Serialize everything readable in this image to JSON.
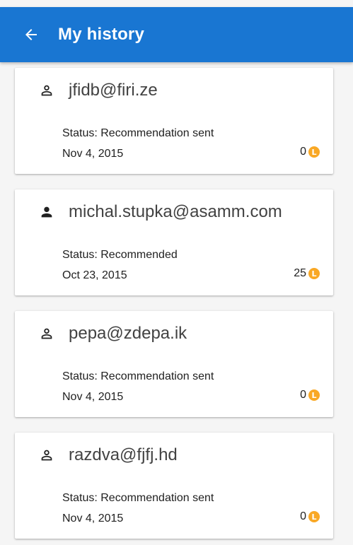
{
  "app_bar": {
    "title": "My history",
    "back_icon": "arrow-left-icon",
    "color": "#1976d2"
  },
  "history": [
    {
      "email": "jfidb@firi.ze",
      "status": "Status: Recommendation sent",
      "date": "Nov 4, 2015",
      "points": "0",
      "icon": "person-outline-icon"
    },
    {
      "email": "michal.stupka@asamm.com",
      "status": "Status: Recommended",
      "date": "Oct 23, 2015",
      "points": "25",
      "icon": "person-filled-icon"
    },
    {
      "email": "pepa@zdepa.ik",
      "status": "Status: Recommendation sent",
      "date": "Nov 4, 2015",
      "points": "0",
      "icon": "person-outline-icon"
    },
    {
      "email": "razdva@fjfj.hd",
      "status": "Status: Recommendation sent",
      "date": "Nov 4, 2015",
      "points": "0",
      "icon": "person-outline-icon"
    }
  ],
  "coin_symbol": "L",
  "coin_color": "#f9a825"
}
